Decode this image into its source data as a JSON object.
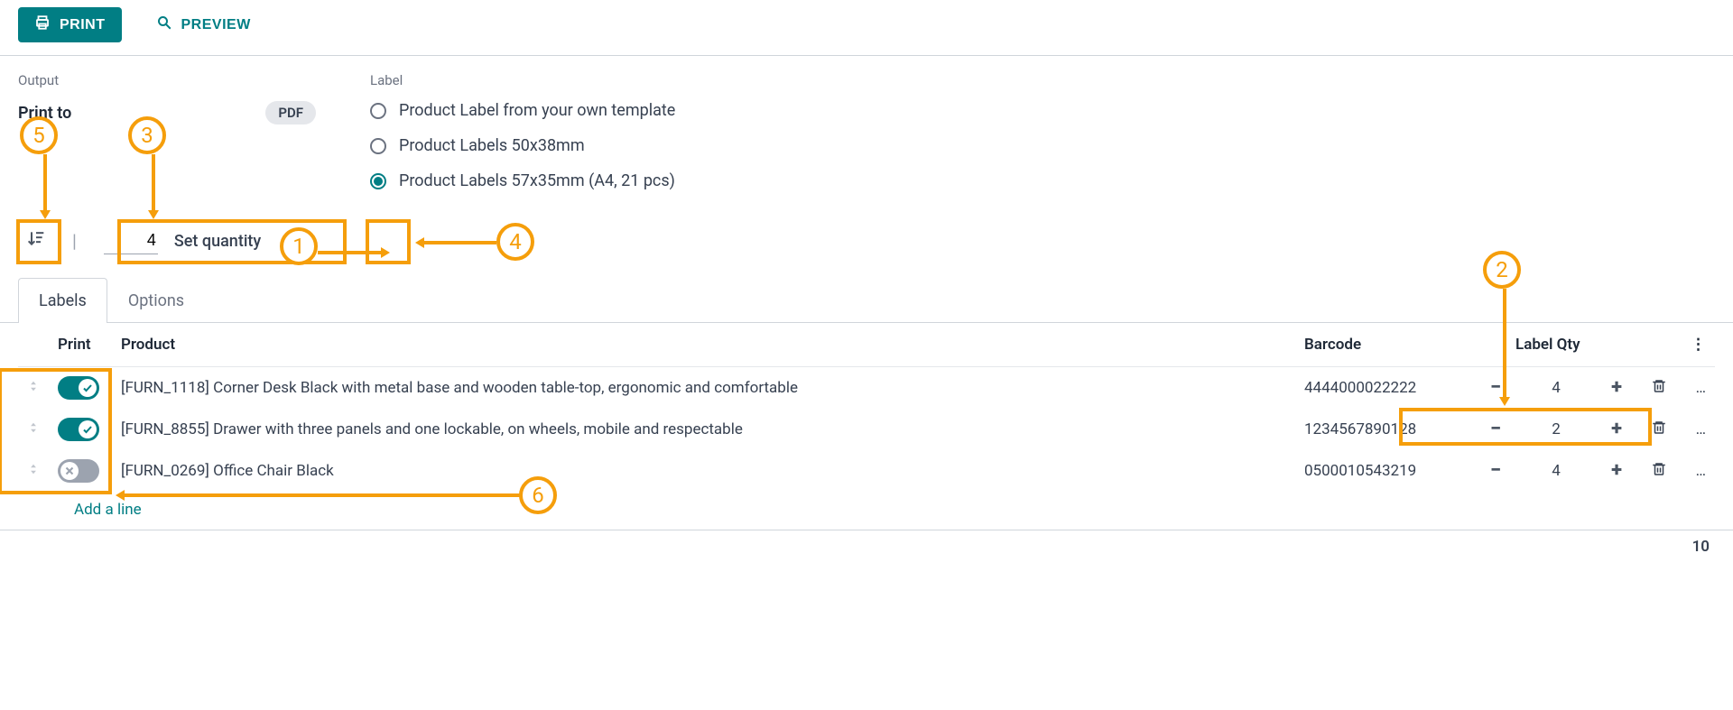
{
  "toolbar": {
    "print_label": "PRINT",
    "preview_label": "PREVIEW"
  },
  "output": {
    "heading": "Output",
    "print_to_label": "Print to",
    "print_to_value": "PDF"
  },
  "label_section": {
    "heading": "Label",
    "options": [
      {
        "label": "Product Label from your own template",
        "checked": false
      },
      {
        "label": "Product Labels 50x38mm",
        "checked": false
      },
      {
        "label": "Product Labels 57x35mm (A4, 21 pcs)",
        "checked": true
      }
    ]
  },
  "controls": {
    "quantity_value": "4",
    "set_quantity_label": "Set quantity"
  },
  "tabs": {
    "labels": "Labels",
    "options": "Options"
  },
  "table": {
    "headers": {
      "print": "Print",
      "product": "Product",
      "barcode": "Barcode",
      "label_qty": "Label Qty"
    },
    "rows": [
      {
        "on": true,
        "product": "[FURN_1118] Corner Desk Black with metal base and wooden table-top, ergonomic and comfortable",
        "barcode": "4444000022222",
        "qty": "4"
      },
      {
        "on": true,
        "product": "[FURN_8855] Drawer with three panels and one lockable, on wheels, mobile and respectable",
        "barcode": "1234567890128",
        "qty": "2"
      },
      {
        "on": false,
        "product": "[FURN_0269] Office Chair Black",
        "barcode": "0500010543219",
        "qty": "4"
      }
    ],
    "add_line": "Add a line"
  },
  "footer": {
    "total": "10"
  },
  "annotations": {
    "n1": "1",
    "n2": "2",
    "n3": "3",
    "n4": "4",
    "n5": "5",
    "n6": "6"
  }
}
